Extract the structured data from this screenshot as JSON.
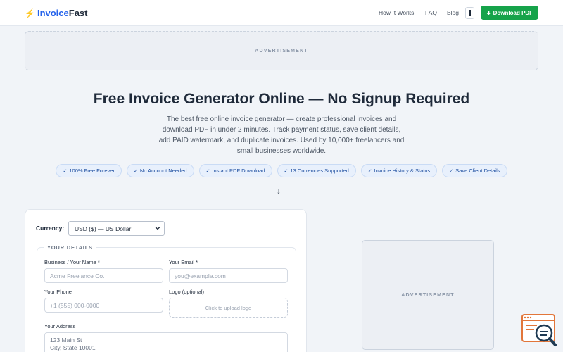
{
  "header": {
    "logo_bolt": "⚡",
    "logo_part1": "Invoice",
    "logo_part2": "Fast",
    "nav": [
      "How It Works",
      "FAQ",
      "Blog"
    ],
    "download_icon": "⬇",
    "download_label": "Download PDF"
  },
  "ads": {
    "top_label": "ADVERTISEMENT",
    "side_label": "ADVERTISEMENT"
  },
  "hero": {
    "title": "Free Invoice Generator Online — No Signup Required",
    "description": "The best free online invoice generator — create professional invoices and download PDF in under 2 minutes. Track payment status, save client details, add PAID watermark, and duplicate invoices. Used by 10,000+ freelancers and small businesses worldwide."
  },
  "features": [
    "100% Free Forever",
    "No Account Needed",
    "Instant PDF Download",
    "13 Currencies Supported",
    "Invoice History & Status",
    "Save Client Details"
  ],
  "check_glyph": "✓",
  "arrow_glyph": "↓",
  "form": {
    "currency_label": "Currency:",
    "currency_value": "USD ($) — US Dollar",
    "section_title": "YOUR DETAILS",
    "business_label": "Business / Your Name *",
    "business_placeholder": "Acme Freelance Co.",
    "email_label": "Your Email *",
    "email_placeholder": "you@example.com",
    "phone_label": "Your Phone",
    "phone_placeholder": "+1 (555) 000-0000",
    "logo_label": "Logo (optional)",
    "logo_upload_text": "Click to upload logo",
    "address_label": "Your Address",
    "address_line1": "123 Main St",
    "address_line2": "City, State 10001"
  },
  "colors": {
    "brand": "#2563eb",
    "download_button": "#16a34a",
    "pill_bg": "#e8f0fc",
    "pill_text": "#1e4fa0"
  },
  "icons": {
    "logo": "bolt-icon",
    "download": "download-icon",
    "feature_check": "check-icon",
    "scroll_hint": "arrow-down-icon",
    "select_caret": "chevron-down-icon",
    "floating_widget": "search-analytics-icon"
  }
}
